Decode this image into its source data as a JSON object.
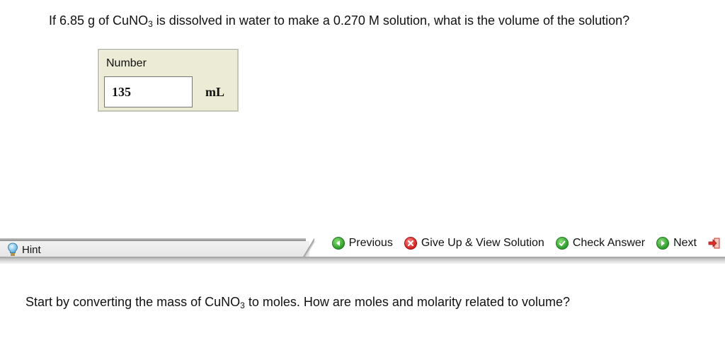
{
  "question": {
    "prefix": "If 6.85 g of CuNO",
    "subscript": "3",
    "suffix": " is dissolved in water to make a 0.270 M solution, what is the volume of the solution?"
  },
  "answer": {
    "label": "Number",
    "value": "135",
    "unit": "mL"
  },
  "toolbar": {
    "hint_label": "Hint",
    "previous_label": "Previous",
    "give_up_label": "Give Up & View Solution",
    "check_answer_label": "Check Answer",
    "next_label": "Next"
  },
  "hint": {
    "prefix": "Start by converting the mass of CuNO",
    "subscript": "3",
    "suffix": " to moles. How are moles and molarity related to volume?"
  },
  "icons": {
    "hint": "lightbulb-icon",
    "previous": "arrow-left-icon",
    "give_up": "x-circle-icon",
    "check": "checkmark-icon",
    "next": "arrow-right-icon",
    "exit": "exit-icon"
  },
  "colors": {
    "answer_box_bg": "#ecebd6",
    "green_icon": "#2d9a2a",
    "red_icon": "#d22020",
    "exit_icon": "#e0302a"
  }
}
